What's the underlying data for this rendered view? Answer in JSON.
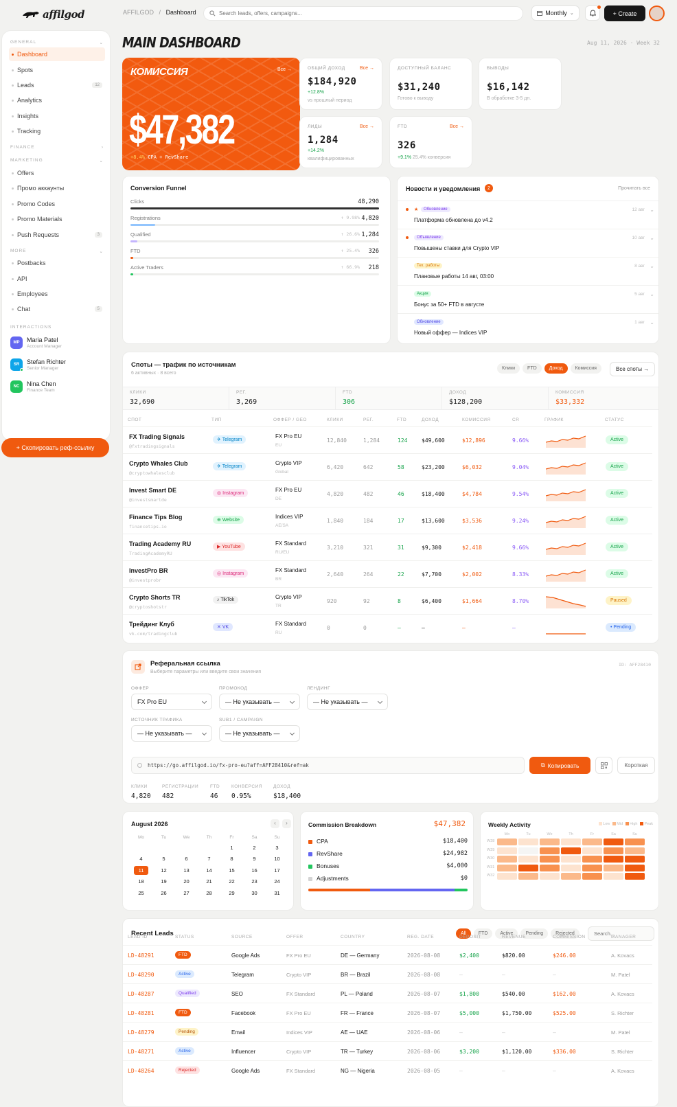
{
  "brand": {
    "logo": "affilgod"
  },
  "header": {
    "crumb_root": "AFFILGOD",
    "crumb_sep": "/",
    "crumb_current": "Dashboard",
    "search_placeholder": "Search leads, offers, campaigns...",
    "period": "Monthly",
    "create": "+ Create"
  },
  "sidebar": {
    "general": "GENERAL",
    "finance": "FINANCE",
    "marketing": "MARKETING",
    "more": "MORE",
    "interactions": "INTERACTIONS",
    "general_items": [
      {
        "label": "Dashboard"
      },
      {
        "label": "Spots"
      },
      {
        "label": "Leads",
        "count": "12"
      },
      {
        "label": "Analytics"
      },
      {
        "label": "Insights"
      },
      {
        "label": "Tracking"
      }
    ],
    "marketing_items": [
      {
        "label": "Offers"
      },
      {
        "label": "Промо аккаунты"
      },
      {
        "label": "Promo Codes"
      },
      {
        "label": "Promo Materials"
      },
      {
        "label": "Push Requests",
        "count": "3"
      }
    ],
    "more_items": [
      {
        "label": "Postbacks"
      },
      {
        "label": "API"
      },
      {
        "label": "Employees"
      },
      {
        "label": "Chat",
        "count": "5"
      }
    ],
    "users": [
      {
        "initials": "MP",
        "name": "Maria Patel",
        "role": "Account Manager",
        "color": "#6366f1"
      },
      {
        "initials": "SR",
        "name": "Stefan Richter",
        "role": "Senior Manager",
        "color": "#0ea5e9"
      },
      {
        "initials": "NC",
        "name": "Nina Chen",
        "role": "Finance Team",
        "color": "#22c55e"
      }
    ],
    "ref_button": "+ Скопировать реф-ссылку"
  },
  "page": {
    "title": "MAIN DASHBOARD",
    "date": "Aug 11, 2026 · Week 32"
  },
  "commission": {
    "label": "КОМИССИЯ",
    "all": "Все →",
    "value": "$47,382",
    "delta": "+8.4%",
    "sub": "CPA + RevShare"
  },
  "kpis": [
    {
      "title": "ОБЩИЙ ДОХОД",
      "all": "Все →",
      "value": "$184,920",
      "delta": "+12.8%",
      "sub": "vs прошлый период"
    },
    {
      "title": "ДОСТУПНЫЙ БАЛАНС",
      "value": "$31,240",
      "sub": "Готово к выводу"
    },
    {
      "title": "ВЫВОДЫ",
      "value": "$16,142",
      "sub": "В обработке 3-5 дн."
    },
    {
      "title": "ЛИДЫ",
      "all": "Все →",
      "value": "1,284",
      "delta": "+14.2%",
      "sub": "квалифицированных"
    },
    {
      "title": "FTD",
      "all": "Все →",
      "value": "326",
      "delta": "+9.1%",
      "sub": "25.4% конверсия"
    }
  ],
  "funnel": {
    "title": "Conversion Funnel",
    "rows": [
      {
        "name": "Clicks",
        "value": "48,290",
        "pct": "",
        "fill": 1.0,
        "color": "#2f2f2f"
      },
      {
        "name": "Registrations",
        "value": "4,820",
        "pct": "↑ 9.98%",
        "fill": 0.1,
        "color": "#93c5fd"
      },
      {
        "name": "Qualified",
        "value": "1,284",
        "pct": "↑ 26.6%",
        "fill": 0.027,
        "color": "#c4b5fd"
      },
      {
        "name": "FTD",
        "value": "326",
        "pct": "↑ 25.4%",
        "fill": 0.007,
        "color": "#f05a0f"
      },
      {
        "name": "Active Traders",
        "value": "218",
        "pct": "↑ 66.9%",
        "fill": 0.005,
        "color": "#22c55e"
      }
    ]
  },
  "news": {
    "title": "Новости и уведомления",
    "count": "2",
    "mark_all": "Прочитать все",
    "items": [
      {
        "tag": "Обновление",
        "tag_bg": "#ede9fe",
        "tag_fg": "#7c3aed",
        "title": "Платформа обновлена до v4.2",
        "date": "12 авг",
        "unread": true,
        "star": true
      },
      {
        "tag": "Объявление",
        "tag_bg": "#ede9fe",
        "tag_fg": "#7c3aed",
        "title": "Повышены ставки для Crypto VIP",
        "date": "10 авг",
        "unread": true
      },
      {
        "tag": "Тех. работы",
        "tag_bg": "#fef3c7",
        "tag_fg": "#d97706",
        "title": "Плановые работы 14 авг, 03:00",
        "date": "8 авг"
      },
      {
        "tag": "Акция",
        "tag_bg": "#dcfce7",
        "tag_fg": "#16a34a",
        "title": "Бонус за 50+ FTD в августе",
        "date": "5 авг"
      },
      {
        "tag": "Обновление",
        "tag_bg": "#e0e7ff",
        "tag_fg": "#4f46e5",
        "title": "Новый оффер — Indices VIP",
        "date": "1 авг"
      }
    ]
  },
  "spots": {
    "title": "Споты — трафик по источникам",
    "subtitle": "6 активных · 8 всего",
    "tabs": [
      "Клики",
      "FTD",
      "Доход",
      "Комиссия"
    ],
    "all": "Все споты →",
    "summary": [
      {
        "k": "КЛИКИ",
        "v": "32,690"
      },
      {
        "k": "РЕГ.",
        "v": "3,269"
      },
      {
        "k": "FTD",
        "v": "306"
      },
      {
        "k": "ДОХОД",
        "v": "$128,200"
      },
      {
        "k": "КОМИССИЯ",
        "v": "$33,332"
      }
    ],
    "headers": [
      "СПОТ",
      "ТИП",
      "ОФФЕР / GEO",
      "КЛИКИ",
      "РЕГ.",
      "FTD",
      "ДОХОД",
      "КОМИССИЯ",
      "CR",
      "ГРАФИК",
      "СТАТУС"
    ],
    "rows": [
      {
        "name": "FX Trading Signals",
        "handle": "@fxtradingsignals",
        "type": "Telegram",
        "offer": "FX Pro EU",
        "geo": "EU",
        "clicks": "12,840",
        "reg": "1,284",
        "ftd": "124",
        "rev": "$49,600",
        "comm": "$12,896",
        "cr": "9.66%",
        "status": "Active",
        "trend": "up"
      },
      {
        "name": "Crypto Whales Club",
        "handle": "@cryptowhalesclub",
        "type": "Telegram",
        "offer": "Crypto VIP",
        "geo": "Global",
        "clicks": "6,420",
        "reg": "642",
        "ftd": "58",
        "rev": "$23,200",
        "comm": "$6,032",
        "cr": "9.04%",
        "status": "Active",
        "trend": "up"
      },
      {
        "name": "Invest Smart DE",
        "handle": "@investsmartde",
        "type": "Instagram",
        "offer": "FX Pro EU",
        "geo": "DE",
        "clicks": "4,820",
        "reg": "482",
        "ftd": "46",
        "rev": "$18,400",
        "comm": "$4,784",
        "cr": "9.54%",
        "status": "Active",
        "trend": "up"
      },
      {
        "name": "Finance Tips Blog",
        "handle": "financetips.io",
        "type": "Website",
        "offer": "Indices VIP",
        "geo": "AE/SA",
        "clicks": "1,840",
        "reg": "184",
        "ftd": "17",
        "rev": "$13,600",
        "comm": "$3,536",
        "cr": "9.24%",
        "status": "Active",
        "trend": "up"
      },
      {
        "name": "Trading Academy RU",
        "handle": "TradingAcademyRU",
        "type": "YouTube",
        "offer": "FX Standard",
        "geo": "RU/EU",
        "clicks": "3,210",
        "reg": "321",
        "ftd": "31",
        "rev": "$9,300",
        "comm": "$2,418",
        "cr": "9.66%",
        "status": "Active",
        "trend": "up"
      },
      {
        "name": "InvestPro BR",
        "handle": "@investprobr",
        "type": "Instagram",
        "offer": "FX Standard",
        "geo": "BR",
        "clicks": "2,640",
        "reg": "264",
        "ftd": "22",
        "rev": "$7,700",
        "comm": "$2,002",
        "cr": "8.33%",
        "status": "Active",
        "trend": "up"
      },
      {
        "name": "Crypto Shorts TR",
        "handle": "@cryptoshotstr",
        "type": "TikTok",
        "offer": "Crypto VIP",
        "geo": "TR",
        "clicks": "920",
        "reg": "92",
        "ftd": "8",
        "rev": "$6,400",
        "comm": "$1,664",
        "cr": "8.70%",
        "status": "Paused",
        "trend": "down"
      },
      {
        "name": "Трейдинг Клуб",
        "handle": "vk.com/tradingclub",
        "type": "VK",
        "offer": "FX Standard",
        "geo": "RU",
        "clicks": "0",
        "reg": "0",
        "ftd": "—",
        "rev": "—",
        "comm": "—",
        "cr": "—",
        "status": "• Pending",
        "trend": "flat"
      }
    ]
  },
  "referral": {
    "title": "Реферальная ссылка",
    "subtitle": "Выберите параметры или введите свои значения",
    "id": "ID: AFF28410",
    "offer_label": "ОФФЕР",
    "offer": "FX Pro EU",
    "promo_label": "ПРОМОКОД",
    "promo": "— Не указывать —",
    "landing_label": "ЛЕНДИНГ",
    "landing": "— Не указывать —",
    "source_label": "ИСТОЧНИК ТРАФИКА",
    "source": "— Не указывать —",
    "sub_label": "SUB1 / CAMPAIGN",
    "sub": "— Не указывать —",
    "url": "https://go.affilgod.io/fx-pro-eu?aff=AFF28410&ref=ak",
    "copy": "Копировать",
    "short": "Короткая",
    "stats": [
      {
        "k": "КЛИКИ",
        "v": "4,820"
      },
      {
        "k": "РЕГИСТРАЦИИ",
        "v": "482"
      },
      {
        "k": "FTD",
        "v": "46"
      },
      {
        "k": "КОНВЕРСИЯ",
        "v": "0.95%"
      },
      {
        "k": "ДОХОД",
        "v": "$18,400"
      }
    ]
  },
  "calendar": {
    "title": "August 2026",
    "days": [
      "Mo",
      "Tu",
      "We",
      "Th",
      "Fr",
      "Sa",
      "Su"
    ],
    "weeks": [
      [
        "",
        "",
        "",
        "",
        "1",
        "2",
        "3"
      ],
      [
        "4",
        "5",
        "6",
        "7",
        "8",
        "9",
        "10"
      ],
      [
        "11",
        "12",
        "13",
        "14",
        "15",
        "16",
        "17"
      ],
      [
        "18",
        "19",
        "20",
        "21",
        "22",
        "23",
        "24"
      ],
      [
        "25",
        "26",
        "27",
        "28",
        "29",
        "30",
        "31"
      ]
    ],
    "today": "11"
  },
  "breakdown": {
    "title": "Commission Breakdown",
    "total": "$47,382",
    "rows": [
      {
        "name": "CPA",
        "value": "$18,400",
        "color": "#f05a0f"
      },
      {
        "name": "RevShare",
        "value": "$24,982",
        "color": "#6366f1"
      },
      {
        "name": "Bonuses",
        "value": "$4,000",
        "color": "#22c55e"
      },
      {
        "name": "Adjustments",
        "value": "$0",
        "color": "#d4d4d4"
      }
    ],
    "shares": [
      0.39,
      0.53,
      0.08
    ]
  },
  "weekly": {
    "title": "Weekly Activity",
    "legend": [
      "Low",
      "Mid",
      "High",
      "Peak"
    ],
    "days": [
      "Mo",
      "Tu",
      "We",
      "Th",
      "Fr",
      "Sa",
      "Su"
    ],
    "weeks": [
      "W28",
      "W29",
      "W30",
      "W31",
      "W32"
    ],
    "levels": [
      [
        2,
        1,
        2,
        1,
        2,
        4,
        3
      ],
      [
        1,
        0,
        3,
        4,
        1,
        3,
        2
      ],
      [
        2,
        1,
        3,
        1,
        3,
        4,
        4
      ],
      [
        2,
        4,
        3,
        1,
        3,
        2,
        4
      ],
      [
        1,
        2,
        1,
        2,
        3,
        1,
        4
      ]
    ]
  },
  "leads": {
    "title": "Recent Leads",
    "tabs": [
      "All",
      "FTD",
      "Active",
      "Pending",
      "Rejected"
    ],
    "search_placeholder": "Search...",
    "headers": [
      "LEAD ID",
      "STATUS",
      "SOURCE",
      "OFFER",
      "COUNTRY",
      "REG. DATE",
      "DEPOSIT",
      "REVENUE",
      "COMMISSION",
      "MANAGER"
    ],
    "rows": [
      {
        "id": "LD-48291",
        "status": "FTD",
        "source": "Google Ads",
        "offer": "FX Pro EU",
        "country": "DE — Germany",
        "date": "2026-08-08",
        "deposit": "$2,400",
        "revenue": "$820.00",
        "comm": "$246.00",
        "mgr": "A. Kovacs"
      },
      {
        "id": "LD-48290",
        "status": "Active",
        "source": "Telegram",
        "offer": "Crypto VIP",
        "country": "BR — Brazil",
        "date": "2026-08-08",
        "deposit": "—",
        "revenue": "—",
        "comm": "—",
        "mgr": "M. Patel"
      },
      {
        "id": "LD-48287",
        "status": "Qualified",
        "source": "SEO",
        "offer": "FX Standard",
        "country": "PL — Poland",
        "date": "2026-08-07",
        "deposit": "$1,800",
        "revenue": "$540.00",
        "comm": "$162.00",
        "mgr": "A. Kovacs"
      },
      {
        "id": "LD-48281",
        "status": "FTD",
        "source": "Facebook",
        "offer": "FX Pro EU",
        "country": "FR — France",
        "date": "2026-08-07",
        "deposit": "$5,000",
        "revenue": "$1,750.00",
        "comm": "$525.00",
        "mgr": "S. Richter"
      },
      {
        "id": "LD-48279",
        "status": "Pending",
        "source": "Email",
        "offer": "Indices VIP",
        "country": "AE — UAE",
        "date": "2026-08-06",
        "deposit": "—",
        "revenue": "—",
        "comm": "—",
        "mgr": "M. Patel"
      },
      {
        "id": "LD-48271",
        "status": "Active",
        "source": "Influencer",
        "offer": "Crypto VIP",
        "country": "TR — Turkey",
        "date": "2026-08-06",
        "deposit": "$3,200",
        "revenue": "$1,120.00",
        "comm": "$336.00",
        "mgr": "S. Richter"
      },
      {
        "id": "LD-48264",
        "status": "Rejected",
        "source": "Google Ads",
        "offer": "FX Standard",
        "country": "NG — Nigeria",
        "date": "2026-08-05",
        "deposit": "—",
        "revenue": "—",
        "comm": "—",
        "mgr": "A. Kovacs"
      }
    ]
  }
}
